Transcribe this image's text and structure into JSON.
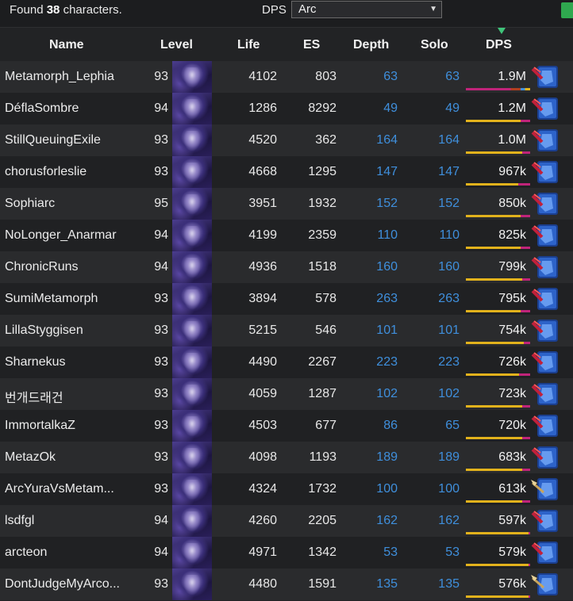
{
  "topbar": {
    "found_prefix": "Found",
    "found_count": "38",
    "found_suffix": "characters.",
    "dps_label": "DPS",
    "dps_selected": "Arc"
  },
  "columns": {
    "name": "Name",
    "level": "Level",
    "life": "Life",
    "es": "ES",
    "depth": "Depth",
    "solo": "Solo",
    "dps": "DPS"
  },
  "colors": {
    "depth_value": "#3f8fdc",
    "bar_yellow": "#e2b21c",
    "bar_pink": "#c0247a",
    "sort_indicator": "#3fc47a"
  },
  "rows": [
    {
      "name": "Metamorph_Lephia",
      "level": "93",
      "life": "4102",
      "es": "803",
      "depth": "63",
      "solo": "63",
      "dps": "1.9M",
      "bar_fraction": 0.0,
      "skill_icon": "arc-skill-icon"
    },
    {
      "name": "DéflaSombre",
      "level": "94",
      "life": "1286",
      "es": "8292",
      "depth": "49",
      "solo": "49",
      "dps": "1.2M",
      "bar_fraction": 0.85,
      "skill_icon": "arc-skill-icon"
    },
    {
      "name": "StillQueuingExile",
      "level": "93",
      "life": "4520",
      "es": "362",
      "depth": "164",
      "solo": "164",
      "dps": "1.0M",
      "bar_fraction": 0.88,
      "skill_icon": "arc-skill-icon"
    },
    {
      "name": "chorusforleslie",
      "level": "93",
      "life": "4668",
      "es": "1295",
      "depth": "147",
      "solo": "147",
      "dps": "967k",
      "bar_fraction": 0.82,
      "skill_icon": "arc-skill-icon"
    },
    {
      "name": "Sophiarc",
      "level": "95",
      "life": "3951",
      "es": "1932",
      "depth": "152",
      "solo": "152",
      "dps": "850k",
      "bar_fraction": 0.85,
      "skill_icon": "arc-skill-icon"
    },
    {
      "name": "NoLonger_Anarmar",
      "level": "94",
      "life": "4199",
      "es": "2359",
      "depth": "110",
      "solo": "110",
      "dps": "825k",
      "bar_fraction": 0.85,
      "skill_icon": "arc-skill-icon"
    },
    {
      "name": "ChronicRuns",
      "level": "94",
      "life": "4936",
      "es": "1518",
      "depth": "160",
      "solo": "160",
      "dps": "799k",
      "bar_fraction": 0.88,
      "skill_icon": "arc-skill-icon"
    },
    {
      "name": "SumiMetamorph",
      "level": "93",
      "life": "3894",
      "es": "578",
      "depth": "263",
      "solo": "263",
      "dps": "795k",
      "bar_fraction": 0.85,
      "skill_icon": "arc-skill-icon"
    },
    {
      "name": "LillaStyggisen",
      "level": "93",
      "life": "5215",
      "es": "546",
      "depth": "101",
      "solo": "101",
      "dps": "754k",
      "bar_fraction": 0.9,
      "skill_icon": "arc-skill-icon"
    },
    {
      "name": "Sharnekus",
      "level": "93",
      "life": "4490",
      "es": "2267",
      "depth": "223",
      "solo": "223",
      "dps": "726k",
      "bar_fraction": 0.83,
      "skill_icon": "arc-skill-icon"
    },
    {
      "name": "번개드래건",
      "level": "93",
      "life": "4059",
      "es": "1287",
      "depth": "102",
      "solo": "102",
      "dps": "723k",
      "bar_fraction": 0.88,
      "skill_icon": "arc-skill-icon"
    },
    {
      "name": "ImmortalkaZ",
      "level": "93",
      "life": "4503",
      "es": "677",
      "depth": "86",
      "solo": "65",
      "dps": "720k",
      "bar_fraction": 0.88,
      "skill_icon": "arc-skill-icon"
    },
    {
      "name": "MetazOk",
      "level": "93",
      "life": "4098",
      "es": "1193",
      "depth": "189",
      "solo": "189",
      "dps": "683k",
      "bar_fraction": 0.88,
      "skill_icon": "arc-skill-icon"
    },
    {
      "name": "ArcYuraVsMetam...",
      "level": "93",
      "life": "4324",
      "es": "1732",
      "depth": "100",
      "solo": "100",
      "dps": "613k",
      "bar_fraction": 0.88,
      "skill_icon": "arc-staff-skill-icon"
    },
    {
      "name": "lsdfgl",
      "level": "94",
      "life": "4260",
      "es": "2205",
      "depth": "162",
      "solo": "162",
      "dps": "597k",
      "bar_fraction": 0.98,
      "skill_icon": "arc-skill-icon"
    },
    {
      "name": "arcteon",
      "level": "94",
      "life": "4971",
      "es": "1342",
      "depth": "53",
      "solo": "53",
      "dps": "579k",
      "bar_fraction": 0.98,
      "skill_icon": "arc-skill-icon"
    },
    {
      "name": "DontJudgeMyArco...",
      "level": "93",
      "life": "4480",
      "es": "1591",
      "depth": "135",
      "solo": "135",
      "dps": "576k",
      "bar_fraction": 0.98,
      "skill_icon": "arc-staff-skill-icon"
    }
  ]
}
